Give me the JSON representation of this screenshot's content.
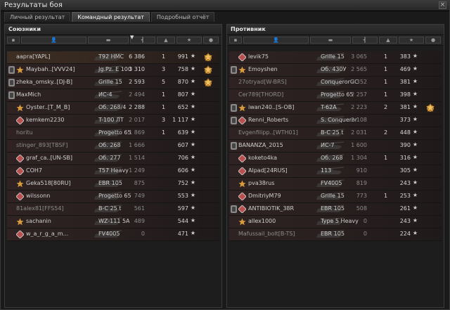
{
  "window": {
    "title": "Результаты боя",
    "close": "×"
  },
  "tabs": [
    "Личный результат",
    "Командный результат",
    "Подробный отчёт"
  ],
  "allies": {
    "title": "Союзники",
    "rows": [
      {
        "name": "aapra[YAPL]",
        "tank": "T92 HMC",
        "damage": "6 386",
        "frags": "1",
        "xp": "991",
        "medal": "yes",
        "hl": true,
        "platoon": false,
        "clan": false
      },
      {
        "name": "Maybah..[VVV24]",
        "tank": "Jg.Pz. E 100",
        "damage": "3 310",
        "frags": "3",
        "xp": "758",
        "medal": "yes",
        "platoon": true,
        "clan": true
      },
      {
        "name": "zheka_omsky..[DJ-B]",
        "tank": "Grille 15",
        "damage": "2 593",
        "frags": "5",
        "xp": "870",
        "medal": "yes",
        "platoon": true,
        "clan": false
      },
      {
        "name": "MaxMich",
        "tank": "ИС-4",
        "damage": "2 494",
        "frags": "1",
        "xp": "807",
        "platoon": true,
        "clan": false,
        "dim": true
      },
      {
        "name": "Oyster..[T_M_B]",
        "tank": "Об. 268/4",
        "damage": "2 288",
        "frags": "1",
        "xp": "652",
        "platoon": false,
        "clan": true
      },
      {
        "name": "kemkem2230",
        "tank": "T-100 ЛТ",
        "damage": "2 017",
        "frags": "3",
        "xp": "1 117",
        "platoon": false,
        "clan": true,
        "dim": true
      },
      {
        "name": "horitu",
        "tank": "Progetto 65",
        "damage": "1 869",
        "frags": "1",
        "xp": "639",
        "dim": true
      },
      {
        "name": "stinger_893[TBSF]",
        "tank": "Об. 268",
        "damage": "1 666",
        "frags": "",
        "xp": "607",
        "dim": true
      },
      {
        "name": "graf_ca..[UN-SB]",
        "tank": "Об. 277",
        "damage": "1 514",
        "frags": "",
        "xp": "706",
        "clan": true,
        "dim": true
      },
      {
        "name": "COH7",
        "tank": "T57 Heavy",
        "damage": "1 249",
        "frags": "",
        "xp": "606",
        "clan": true,
        "dim": true
      },
      {
        "name": "Geka518[80RU]",
        "tank": "EBR 105",
        "damage": "875",
        "frags": "",
        "xp": "752",
        "clan": true,
        "dim": true
      },
      {
        "name": "wilssonn",
        "tank": "Progetto 65",
        "damage": "749",
        "frags": "",
        "xp": "553",
        "clan": true,
        "dim": true
      },
      {
        "name": "81alex81[FFS54]",
        "tank": "B-C 25 t",
        "damage": "561",
        "frags": "",
        "xp": "597",
        "dim": true
      },
      {
        "name": "sachanin",
        "tank": "WZ-111 5A",
        "damage": "489",
        "frags": "",
        "xp": "544",
        "clan": true,
        "dim": true
      },
      {
        "name": "w_a_r_g_a_m...",
        "tank": "FV4005",
        "damage": "0",
        "frags": "",
        "xp": "471",
        "clan": true,
        "dim": true
      }
    ]
  },
  "enemies": {
    "title": "Противник",
    "rows": [
      {
        "name": "levik75",
        "tank": "Grille 15",
        "damage": "3 065",
        "frags": "1",
        "xp": "383",
        "clan": true,
        "dim": true
      },
      {
        "name": "Emoyshen",
        "tank": "Об. 430У",
        "damage": "2 565",
        "frags": "1",
        "xp": "469",
        "platoon": true,
        "clan": true,
        "dim": true
      },
      {
        "name": "27otryad[W-BRS]",
        "tank": "ConquerorGC",
        "damage": "2 352",
        "frags": "1",
        "xp": "381",
        "dim": true
      },
      {
        "name": "Cer789[THORD]",
        "tank": "Progetto 65",
        "damage": "2 257",
        "frags": "1",
        "xp": "398",
        "dim": true
      },
      {
        "name": "iwan240..[S-OB]",
        "tank": "T-62A",
        "damage": "2 223",
        "frags": "2",
        "xp": "381",
        "platoon": true,
        "clan": true,
        "medal": "yes",
        "dim": true
      },
      {
        "name": "Renni_Roberts",
        "tank": "S. Conqueror",
        "damage": "2 108",
        "frags": "",
        "xp": "373",
        "platoon": true,
        "clan": true,
        "dim": true
      },
      {
        "name": "Evgenfilipp..[WTH01]",
        "tank": "B-C 25 t",
        "damage": "2 031",
        "frags": "2",
        "xp": "448",
        "dim": true
      },
      {
        "name": "BANANZA_2015",
        "tank": "ИС-7",
        "damage": "1 600",
        "frags": "",
        "xp": "390",
        "platoon": true,
        "dim": true
      },
      {
        "name": "koketo4ka",
        "tank": "Об. 268",
        "damage": "1 304",
        "frags": "1",
        "xp": "316",
        "clan": true,
        "dim": true
      },
      {
        "name": "Alpad[24RUS]",
        "tank": "113",
        "damage": "910",
        "frags": "",
        "xp": "305",
        "clan": true,
        "dim": true
      },
      {
        "name": "pva38rus",
        "tank": "FV4005",
        "damage": "819",
        "frags": "",
        "xp": "243",
        "clan": true,
        "dim": true
      },
      {
        "name": "DmitriyM79",
        "tank": "Grille 15",
        "damage": "773",
        "frags": "1",
        "xp": "253",
        "clan": true,
        "dim": true
      },
      {
        "name": "ANTIBIOTIK_38R",
        "tank": "EBR 105",
        "damage": "508",
        "frags": "",
        "xp": "261",
        "platoon": true,
        "clan": true,
        "dim": true
      },
      {
        "name": "allex1000",
        "tank": "Type 5 Heavy",
        "damage": "0",
        "frags": "",
        "xp": "243",
        "clan": true,
        "dim": true
      },
      {
        "name": "Mafussail_bolt[B-TS]",
        "tank": "EBR 105",
        "damage": "0",
        "frags": "",
        "xp": "224",
        "dim": true
      }
    ]
  },
  "colors": {
    "accent_gold": "#e0a53a",
    "row_red": "#2e2322",
    "row_highlight": "#3c2e22"
  },
  "icons": {
    "platoon": "platoon-icon",
    "clan": "clan-emblem-icon",
    "xp": "star-icon",
    "medal": "medal-icon"
  }
}
